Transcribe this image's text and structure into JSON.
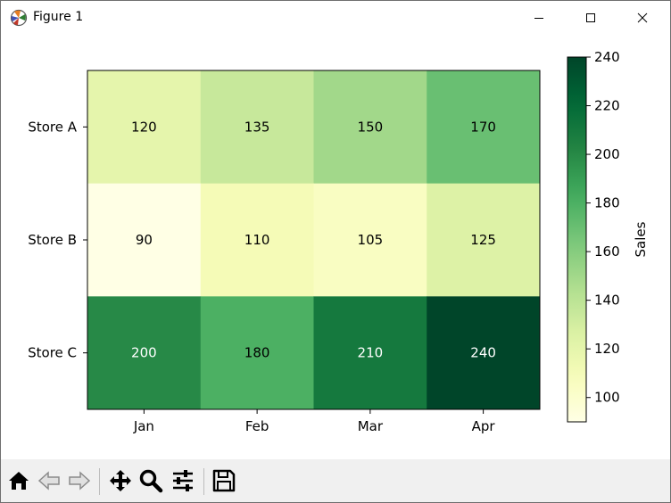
{
  "window": {
    "title": "Figure 1",
    "minimize_icon": "minimize-icon",
    "maximize_icon": "maximize-icon",
    "close_icon": "close-icon"
  },
  "toolbar": {
    "buttons": [
      {
        "name": "home-button",
        "icon": "home-icon"
      },
      {
        "name": "back-button",
        "icon": "back-arrow-icon"
      },
      {
        "name": "forward-button",
        "icon": "forward-arrow-icon"
      },
      {
        "name": "pan-button",
        "icon": "pan-move-icon"
      },
      {
        "name": "zoom-button",
        "icon": "zoom-magnifier-icon"
      },
      {
        "name": "configure-subplots-button",
        "icon": "sliders-icon"
      },
      {
        "name": "save-button",
        "icon": "save-disk-icon"
      }
    ]
  },
  "chart_data": {
    "type": "heatmap",
    "title": "",
    "xlabel": "",
    "ylabel": "",
    "x_categories": [
      "Jan",
      "Feb",
      "Mar",
      "Apr"
    ],
    "y_categories": [
      "Store A",
      "Store B",
      "Store C"
    ],
    "values": [
      [
        120,
        135,
        150,
        170
      ],
      [
        90,
        110,
        105,
        125
      ],
      [
        200,
        180,
        210,
        240
      ]
    ],
    "colormap": "YlGn",
    "vmin": 90,
    "vmax": 240,
    "colorbar": {
      "label": "Sales",
      "ticks": [
        100,
        120,
        140,
        160,
        180,
        200,
        220,
        240
      ]
    },
    "cell_text_colors": {
      "dark": "#000000",
      "light": "#ffffff"
    }
  }
}
